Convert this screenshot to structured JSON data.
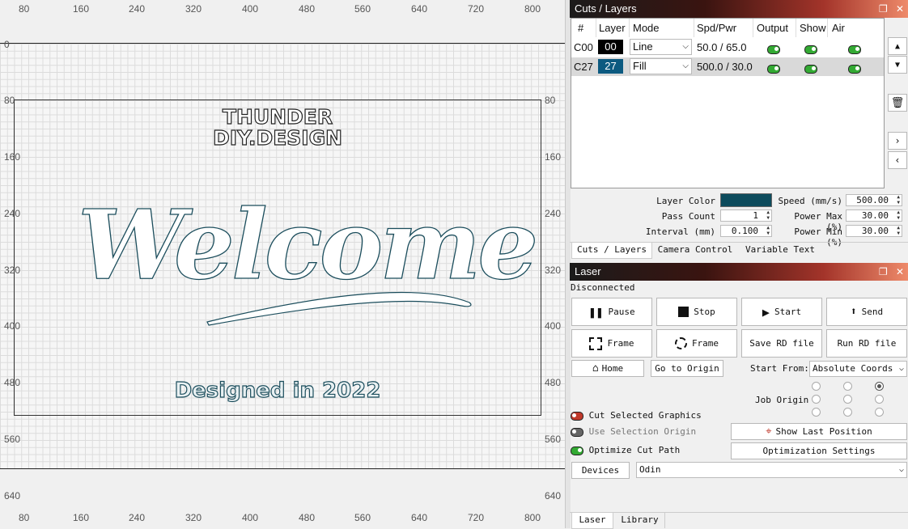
{
  "canvas": {
    "ruler_top": [
      "80",
      "160",
      "240",
      "320",
      "400",
      "480",
      "560",
      "640",
      "720",
      "800"
    ],
    "ruler_bottom": [
      "80",
      "160",
      "240",
      "320",
      "400",
      "480",
      "560",
      "640",
      "720",
      "800"
    ],
    "ruler_left": [
      "0",
      "80",
      "160",
      "240",
      "320",
      "400",
      "480",
      "560",
      "640"
    ],
    "ruler_right": [
      "80",
      "160",
      "240",
      "320",
      "400",
      "480",
      "560",
      "640"
    ],
    "design": {
      "line1": "THUNDER",
      "line2": "DIY.DESIGN",
      "welcome": "Welcome",
      "footer": "Designed in 2022"
    }
  },
  "cuts_panel": {
    "title": "Cuts / Layers",
    "columns": [
      "#",
      "Layer",
      "Mode",
      "Spd/Pwr",
      "Output",
      "Show",
      "Air"
    ],
    "rows": [
      {
        "id": "C00",
        "layer": "00",
        "layer_color": "#000000",
        "mode": "Line",
        "spdpwr": "50.0 / 65.0"
      },
      {
        "id": "C27",
        "layer": "27",
        "layer_color": "#0c5a80",
        "mode": "Fill",
        "spdpwr": "500.0 / 30.0"
      }
    ],
    "layer_color_label": "Layer Color",
    "layer_color_value": "#0d4b5c",
    "pass_count_label": "Pass Count",
    "pass_count": "1",
    "interval_label": "Interval (mm)",
    "interval": "0.100",
    "speed_label": "Speed (mm/s)",
    "speed": "500.00",
    "power_max_label": "Power Max (%)",
    "power_max": "30.00",
    "power_min_label": "Power Min (%)",
    "power_min": "30.00",
    "tabs": [
      "Cuts / Layers",
      "Camera Control",
      "Variable Text"
    ]
  },
  "laser_panel": {
    "title": "Laser",
    "status": "Disconnected",
    "buttons": {
      "pause": "Pause",
      "stop": "Stop",
      "start": "Start",
      "send": "Send",
      "frame1": "Frame",
      "frame2": "Frame",
      "save_rd": "Save RD file",
      "run_rd": "Run RD file",
      "home": "Home",
      "go_origin": "Go to Origin"
    },
    "start_from_label": "Start From:",
    "start_from_value": "Absolute Coords",
    "job_origin_label": "Job Origin",
    "cut_selected": "Cut Selected Graphics",
    "use_selection_origin": "Use Selection Origin",
    "optimize_cut_path": "Optimize Cut Path",
    "show_last_position": "Show Last Position",
    "optimization_settings": "Optimization Settings",
    "devices_label": "Devices",
    "device_value": "Odin",
    "bottom_tabs": [
      "Laser",
      "Library"
    ]
  }
}
